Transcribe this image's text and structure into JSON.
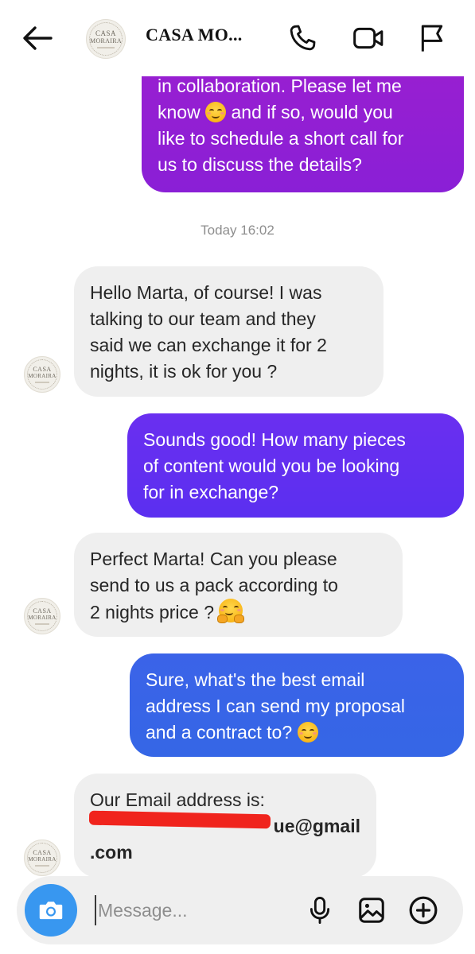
{
  "header": {
    "title": "CASA MO...",
    "avatar_text": [
      "CASA",
      "MORAIRA"
    ]
  },
  "messages": [
    {
      "direction": "outgoing",
      "lines": [
        "in collaboration. Please let me",
        "know",
        " and if so, would you",
        "like to schedule a short call for",
        "us to discuss the details?"
      ],
      "gradient": [
        "#9a1fd0",
        "#8a1fd6"
      ]
    },
    {
      "direction": "incoming",
      "lines": [
        "Hello Marta, of course! I was",
        "talking to our team and they",
        "said we can exchange it for 2",
        "nights, it is ok for you ?"
      ]
    },
    {
      "direction": "outgoing",
      "lines": [
        "Sounds good! How many pieces",
        "of content would you be looking",
        "for in exchange?"
      ],
      "gradient": [
        "#6a2ff0",
        "#5b2ff0"
      ]
    },
    {
      "direction": "incoming",
      "lines": [
        "Perfect Marta! Can you please",
        "send to us a pack according to",
        "2 nights price ?"
      ]
    },
    {
      "direction": "outgoing",
      "lines": [
        "Sure, what's the best email",
        "address I can send my proposal",
        "and a contract to?"
      ],
      "gradient": [
        "#3b63e8",
        "#3566e6"
      ]
    },
    {
      "direction": "incoming",
      "lines": [
        "Our Email address is:",
        "ue@gmail",
        ".com"
      ]
    }
  ],
  "timestamp": "Today 16:02",
  "composer": {
    "placeholder": "Message..."
  },
  "colors": {
    "camera_button": "#3897f0",
    "incoming_bubble": "#efefef",
    "redaction": "#f0241d"
  },
  "icons": [
    "back-arrow-icon",
    "phone-icon",
    "video-call-icon",
    "flag-icon",
    "camera-icon",
    "microphone-icon",
    "gallery-icon",
    "add-icon",
    "smiling-face-emoji",
    "hugging-face-emoji"
  ]
}
